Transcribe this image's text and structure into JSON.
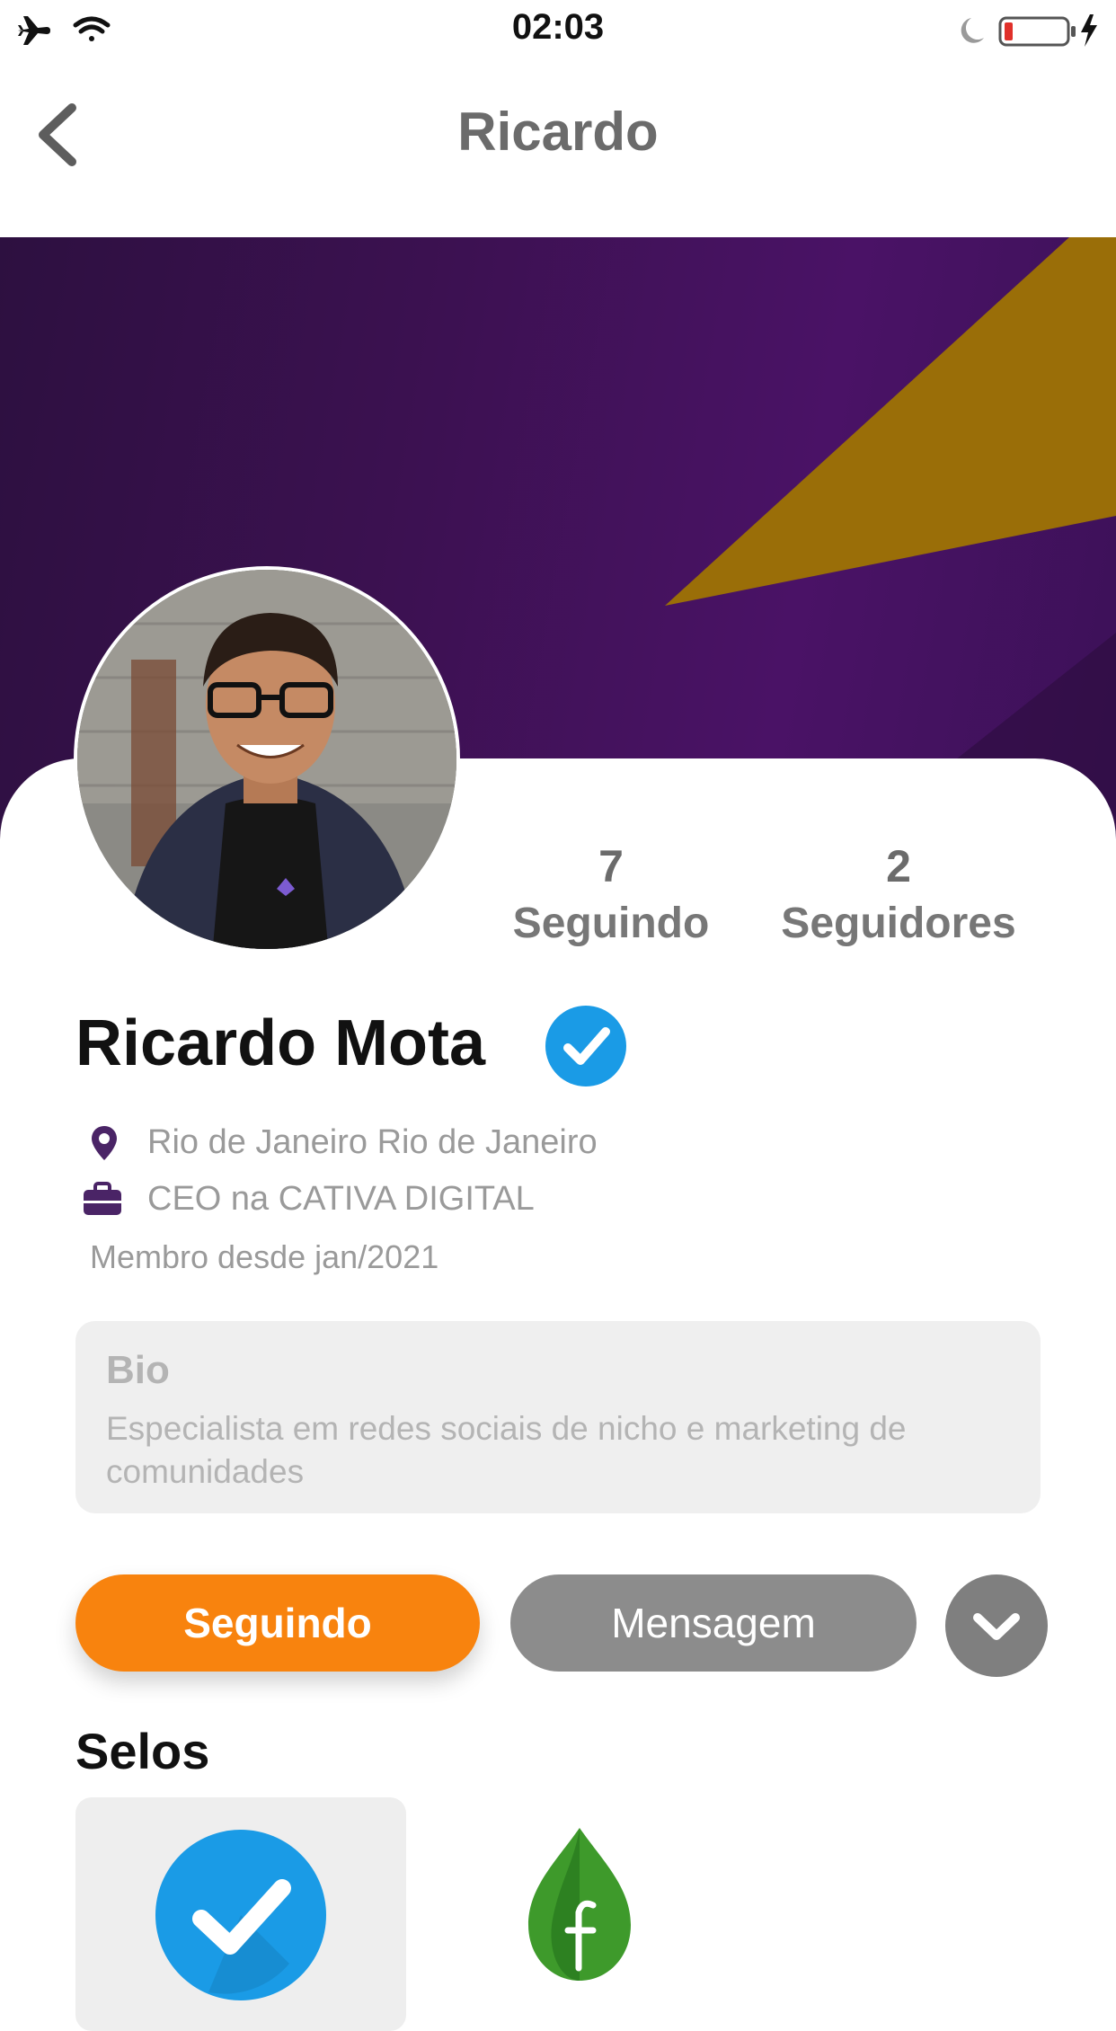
{
  "status_bar": {
    "time": "02:03",
    "left_icons": [
      "airplane-icon",
      "wifi-icon"
    ],
    "right_icons": [
      "moon-icon",
      "battery-icon",
      "charging-icon"
    ],
    "battery_level": 0.12
  },
  "nav": {
    "title": "Ricardo",
    "back_icon": "chevron-left-icon"
  },
  "colors": {
    "cover_purple": "#3b1150",
    "cover_accent": "#9a6e08",
    "follow_orange": "#f8830e",
    "verified_blue": "#1a9be6",
    "icon_purple": "#4a2466"
  },
  "stats": {
    "following_count": "7",
    "following_label": "Seguindo",
    "followers_count": "2",
    "followers_label": "Seguidores"
  },
  "profile": {
    "name": "Ricardo Mota",
    "verified": true,
    "location": "Rio de Janeiro Rio de Janeiro",
    "job": "CEO na CATIVA DIGITAL",
    "member_since": "Membro desde jan/2021"
  },
  "bio": {
    "title": "Bio",
    "text": "Especialista em redes sociais de nicho e marketing de comunidades"
  },
  "actions": {
    "follow_label": "Seguindo",
    "message_label": "Mensagem",
    "more_icon": "chevron-down-icon"
  },
  "seals": {
    "title": "Selos",
    "items": [
      "verified-seal-icon",
      "leaf-seal-icon"
    ]
  }
}
